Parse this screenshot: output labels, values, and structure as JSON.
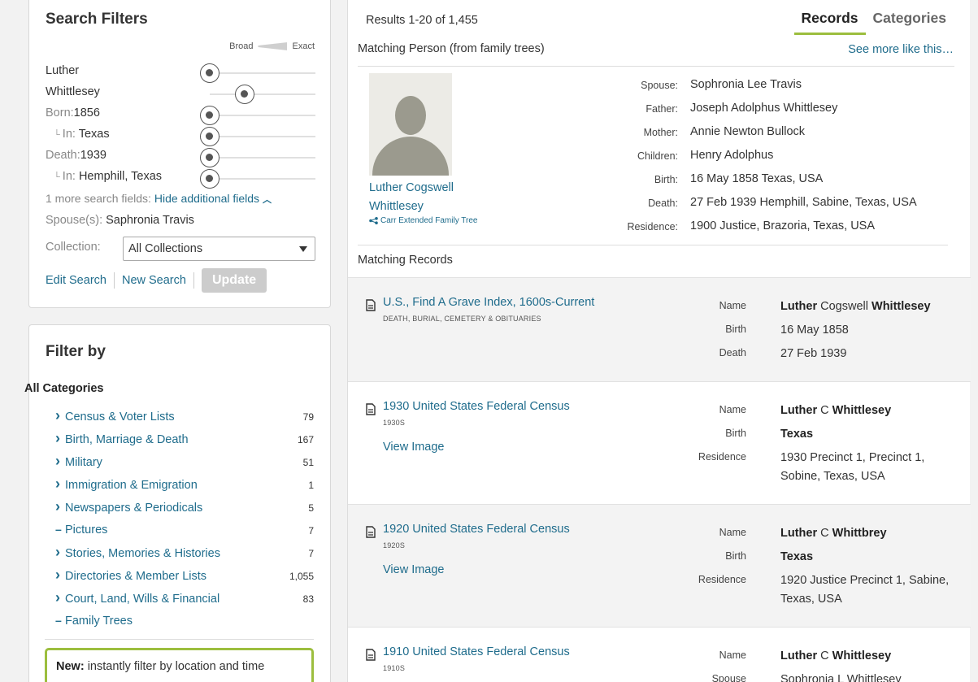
{
  "search": {
    "title": "Search Filters",
    "broad_label": "Broad",
    "exact_label": "Exact",
    "first_name": "Luther",
    "last_name": "Whittlesey",
    "born_label": "Born:",
    "born_value": "1856",
    "in_label": "In:",
    "born_place": "Texas",
    "death_label": "Death:",
    "death_value": "1939",
    "death_place": "Hemphill, Texas",
    "more_fields_text": "1 more search fields:",
    "hide_fields_link": "Hide additional fields",
    "spouse_label": "Spouse(s):",
    "spouse_value": "Saphronia Travis",
    "collection_label": "Collection:",
    "collection_value": "All Collections",
    "edit_search": "Edit Search",
    "new_search": "New Search",
    "update": "Update"
  },
  "filter": {
    "title": "Filter by",
    "all_categories": "All Categories",
    "categories": [
      {
        "label": "Census & Voter Lists",
        "count": "79",
        "icon": "chevron-right"
      },
      {
        "label": "Birth, Marriage & Death",
        "count": "167",
        "icon": "chevron-right"
      },
      {
        "label": "Military",
        "count": "51",
        "icon": "chevron-right"
      },
      {
        "label": "Immigration & Emigration",
        "count": "1",
        "icon": "chevron-right"
      },
      {
        "label": "Newspapers & Periodicals",
        "count": "5",
        "icon": "chevron-right"
      },
      {
        "label": "Pictures",
        "count": "7",
        "icon": "dash"
      },
      {
        "label": "Stories, Memories & Histories",
        "count": "7",
        "icon": "chevron-right"
      },
      {
        "label": "Directories & Member Lists",
        "count": "1,055",
        "icon": "chevron-right"
      },
      {
        "label": "Court, Land, Wills & Financial",
        "count": "83",
        "icon": "chevron-right"
      },
      {
        "label": "Family Trees",
        "count": "",
        "icon": "dash"
      }
    ],
    "new_bold": "New:",
    "new_text": "instantly filter by location and time"
  },
  "main": {
    "results": "Results 1-20 of 1,455",
    "tab_records": "Records",
    "tab_categories": "Categories",
    "matching_person": "Matching Person (from family trees)",
    "see_more": "See more like this…",
    "person": {
      "name_line1": "Luther Cogswell",
      "name_line2": "Whittlesey",
      "tree": "Carr Extended Family Tree",
      "fields": [
        {
          "k": "Spouse:",
          "v": "Sophronia Lee Travis"
        },
        {
          "k": "Father:",
          "v": "Joseph Adolphus Whittlesey"
        },
        {
          "k": "Mother:",
          "v": "Annie Newton Bullock"
        },
        {
          "k": "Children:",
          "v": "Henry Adolphus"
        },
        {
          "k": "Birth:",
          "v": "16 May 1858 Texas, USA"
        },
        {
          "k": "Death:",
          "v": "27 Feb 1939 Hemphill, Sabine, Texas, USA"
        },
        {
          "k": "Residence:",
          "v": "1900 Justice, Brazoria, Texas, USA"
        }
      ]
    },
    "matching_records": "Matching Records",
    "records": [
      {
        "title": "U.S., Find A Grave Index, 1600s-Current",
        "sub": "DEATH, BURIAL, CEMETERY & OBITUARIES",
        "view": "",
        "name_first": "Luther",
        "name_mid": "Cogswell",
        "name_last": "Whittlesey",
        "f2k": "Birth",
        "f2v": "16 May 1858",
        "f3k": "Death",
        "f3v": "27 Feb 1939"
      },
      {
        "title": "1930 United States Federal Census",
        "sub": "1930S",
        "view": "View Image",
        "name_first": "Luther",
        "name_mid": "C",
        "name_last": "Whittlesey",
        "f2k": "Birth",
        "f2v": "Texas",
        "f3k": "Residence",
        "f3v": "1930 Precinct 1, Precinct 1, Sobine, Texas, USA"
      },
      {
        "title": "1920 United States Federal Census",
        "sub": "1920S",
        "view": "View Image",
        "name_first": "Luther",
        "name_mid": "C",
        "name_last": "Whittbrey",
        "f2k": "Birth",
        "f2v": "Texas",
        "f3k": "Residence",
        "f3v": "1920 Justice Precinct 1, Sabine, Texas, USA"
      },
      {
        "title": "1910 United States Federal Census",
        "sub": "1910S",
        "view": "",
        "name_first": "Luther",
        "name_mid": "C",
        "name_last": "Whittlesey",
        "f2k": "Spouse",
        "f2v": "Sophronia L Whittlesey",
        "f3k": "",
        "f3v": ""
      }
    ]
  },
  "colors": {
    "accent": "#9cbe3e",
    "link": "#1f6c8c",
    "shade": "#f3f3f3"
  }
}
